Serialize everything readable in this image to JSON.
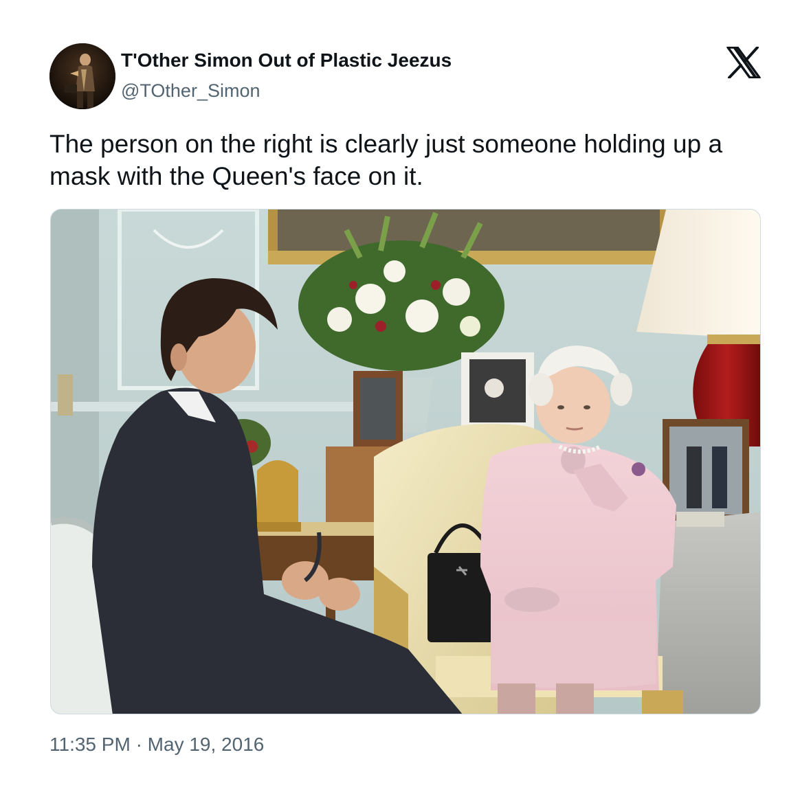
{
  "author": {
    "display_name": "T'Other Simon Out of Plastic Jeezus",
    "handle": "@TOther_Simon",
    "avatar_icon": "profile-photo-avatar"
  },
  "platform_logo_icon": "x-logo-icon",
  "tweet": {
    "text": "The person on the right is clearly just someone holding up a mask with the Queen's face on it."
  },
  "media": {
    "type": "photo"
  },
  "meta": {
    "time": "11:35 PM",
    "separator": "·",
    "date": "May 19, 2016"
  },
  "colors": {
    "text_primary": "#0f1419",
    "text_secondary": "#536471",
    "border": "#cfd9de",
    "background": "#ffffff"
  }
}
